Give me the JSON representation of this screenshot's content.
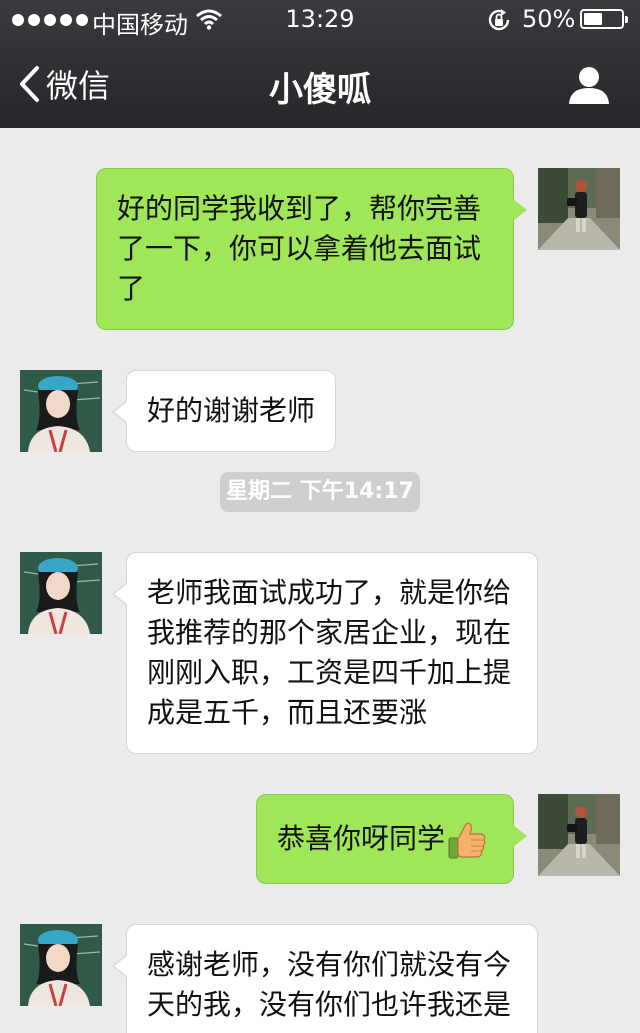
{
  "status_bar": {
    "carrier": "中国移动",
    "time": "13:29",
    "battery": "50%",
    "battery_level": 0.5
  },
  "nav": {
    "back_label": "微信",
    "title": "小傻呱"
  },
  "timestamp": "星期二 下午14:17",
  "messages": [
    {
      "direction": "outgoing",
      "text": "好的同学我收到了，帮你完善了一下，你可以拿着他去面试了"
    },
    {
      "direction": "incoming",
      "text": "好的谢谢老师"
    },
    {
      "direction": "incoming",
      "text": "老师我面试成功了，就是你给我推荐的那个家居企业，现在刚刚入职，工资是四千加上提成是五千，而且还要涨"
    },
    {
      "direction": "outgoing",
      "text": "恭喜你呀同学",
      "emoji": "thumbs-up"
    },
    {
      "direction": "incoming",
      "text": "感谢老师，没有你们就没有今天的我，没有你们也许我还是"
    }
  ],
  "icons": {
    "back": "chevron-left-icon",
    "profile": "person-icon",
    "wifi": "wifi-icon",
    "lock": "rotation-lock-icon"
  },
  "colors": {
    "outgoing_bubble": "#9fe658",
    "incoming_bubble": "#ffffff",
    "nav_bar": "#2e2e32",
    "chat_background": "#ebebeb"
  }
}
